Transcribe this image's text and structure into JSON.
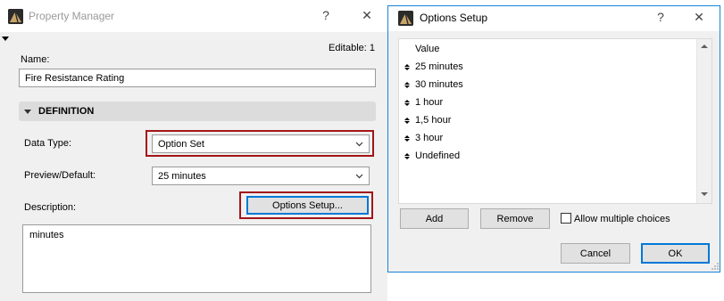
{
  "property_manager": {
    "title": "Property Manager",
    "help_glyph": "?",
    "close_glyph": "✕",
    "editable_label": "Editable: 1",
    "name_label": "Name:",
    "name_value": "Fire Resistance Rating",
    "definition_header": "DEFINITION",
    "data_type_label": "Data Type:",
    "data_type_value": "Option Set",
    "preview_label": "Preview/Default:",
    "preview_value": "25 minutes",
    "description_label": "Description:",
    "options_setup_button": "Options Setup...",
    "description_value": "minutes"
  },
  "options_setup": {
    "title": "Options Setup",
    "help_glyph": "?",
    "close_glyph": "✕",
    "list_header": "Value",
    "items": [
      "25 minutes",
      "30 minutes",
      "1 hour",
      "1,5 hour",
      "3 hour",
      "Undefined"
    ],
    "add_button": "Add",
    "remove_button": "Remove",
    "allow_multiple_label": "Allow multiple choices",
    "allow_multiple_checked": false,
    "cancel_button": "Cancel",
    "ok_button": "OK"
  },
  "colors": {
    "highlight_frame": "#a31519",
    "dialog_accent": "#1883d7",
    "panel_bg": "#f0f0f0"
  },
  "icons": [
    "archicad-app-icon",
    "help-icon",
    "close-icon",
    "chevron-down-icon",
    "reorder-handle-icon",
    "resize-grip-icon"
  ]
}
